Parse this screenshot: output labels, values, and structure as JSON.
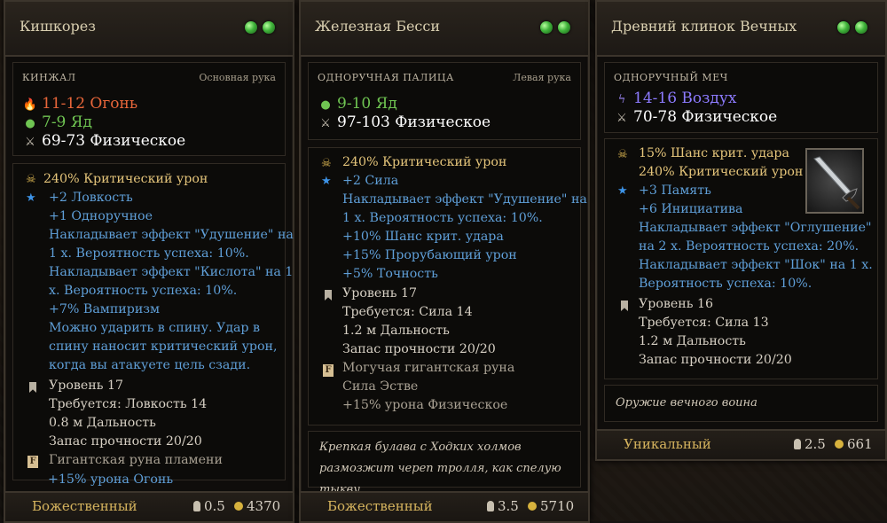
{
  "cards": [
    {
      "title": "Кишкорез",
      "base_type": "КИНЖАЛ",
      "slot": "Основная рука",
      "damage": [
        {
          "icon": "fire-icon",
          "text": "11-12 Огонь",
          "color": "#e8663a"
        },
        {
          "icon": "poison-icon",
          "text": "7-9 Яд",
          "color": "#6fc452"
        },
        {
          "icon": "swords-icon",
          "text": "69-73 Физическое",
          "color": "#ffffff"
        }
      ],
      "stats": [
        {
          "icon": "skull-icon",
          "text": "240% Критический урон",
          "cls": "gold"
        },
        {
          "icon": "star-icon",
          "text": "+2 Ловкость",
          "cls": "blue"
        },
        {
          "icon": "",
          "text": "+1 Одноручное",
          "cls": "blue"
        },
        {
          "icon": "",
          "text": "Накладывает эффект \"Удушение\" на",
          "cls": "blue"
        },
        {
          "icon": "",
          "text": "1 х. Вероятность успеха: 10%.",
          "cls": "blue"
        },
        {
          "icon": "",
          "text": "Накладывает эффект \"Кислота\" на 1",
          "cls": "blue"
        },
        {
          "icon": "",
          "text": "х. Вероятность успеха: 10%.",
          "cls": "blue"
        },
        {
          "icon": "",
          "text": "+7% Вампиризм",
          "cls": "blue"
        },
        {
          "icon": "",
          "text": "Можно ударить в спину. Удар в",
          "cls": "blue"
        },
        {
          "icon": "",
          "text": "спину наносит критический урон,",
          "cls": "blue"
        },
        {
          "icon": "",
          "text": "когда вы атакуете цель сзади.",
          "cls": "blue"
        },
        {
          "icon": "bookmark-icon",
          "text": "Уровень 17",
          "cls": "white"
        },
        {
          "icon": "",
          "text": "Требуется: Ловкость 14",
          "cls": "white"
        },
        {
          "icon": "",
          "text": "0.8 м Дальность",
          "cls": "white"
        },
        {
          "icon": "",
          "text": "Запас прочности 20/20",
          "cls": "white"
        },
        {
          "icon": "rune-icon",
          "text": "Гигантская руна пламени",
          "cls": "grey"
        },
        {
          "icon": "",
          "text": "+15% урона Огонь",
          "cls": "blue"
        }
      ],
      "description": "",
      "rarity": "Божественный",
      "weight": "0.5",
      "value": "4370"
    },
    {
      "title": "Железная Бесси",
      "base_type": "ОДНОРУЧНАЯ ПАЛИЦА",
      "slot": "Левая рука",
      "damage": [
        {
          "icon": "poison-icon",
          "text": "9-10 Яд",
          "color": "#6fc452"
        },
        {
          "icon": "swords-icon",
          "text": "97-103 Физическое",
          "color": "#ffffff"
        }
      ],
      "stats": [
        {
          "icon": "skull-icon",
          "text": "240% Критический урон",
          "cls": "gold"
        },
        {
          "icon": "star-icon",
          "text": "+2 Сила",
          "cls": "blue"
        },
        {
          "icon": "",
          "text": "Накладывает эффект \"Удушение\" на",
          "cls": "blue"
        },
        {
          "icon": "",
          "text": "1 х. Вероятность успеха: 10%.",
          "cls": "blue"
        },
        {
          "icon": "",
          "text": "+10% Шанс крит. удара",
          "cls": "blue"
        },
        {
          "icon": "",
          "text": "+15% Прорубающий урон",
          "cls": "blue"
        },
        {
          "icon": "",
          "text": "+5% Точность",
          "cls": "blue"
        },
        {
          "icon": "bookmark-icon",
          "text": "Уровень 17",
          "cls": "white"
        },
        {
          "icon": "",
          "text": "Требуется: Сила 14",
          "cls": "white"
        },
        {
          "icon": "",
          "text": "1.2 м Дальность",
          "cls": "white"
        },
        {
          "icon": "",
          "text": "Запас прочности 20/20",
          "cls": "white"
        },
        {
          "icon": "rune-icon",
          "text": "Могучая гигантская руна",
          "cls": "grey"
        },
        {
          "icon": "",
          "text": "Сила Эстве",
          "cls": "grey"
        },
        {
          "icon": "",
          "text": "+15% урона Физическое",
          "cls": "grey"
        }
      ],
      "description": "Крепкая булава с Ходких холмов размозжит череп тролля, как спелую тыкву.",
      "rarity": "Божественный",
      "weight": "3.5",
      "value": "5710"
    },
    {
      "title": "Древний клинок Вечных",
      "base_type": "ОДНОРУЧНЫЙ МЕЧ",
      "slot": "",
      "damage": [
        {
          "icon": "lightning-icon",
          "text": "14-16 Воздух",
          "color": "#8d7bff"
        },
        {
          "icon": "swords-icon",
          "text": "70-78 Физическое",
          "color": "#ffffff"
        }
      ],
      "stats": [
        {
          "icon": "skull-icon",
          "text": "15% Шанс крит. удара",
          "cls": "gold"
        },
        {
          "icon": "",
          "text": "240% Критический урон",
          "cls": "gold"
        },
        {
          "icon": "star-icon",
          "text": "+3 Память",
          "cls": "blue"
        },
        {
          "icon": "",
          "text": "+6 Инициатива",
          "cls": "blue"
        },
        {
          "icon": "",
          "text": "Накладывает эффект \"Оглушение\"",
          "cls": "blue"
        },
        {
          "icon": "",
          "text": "на 2 х. Вероятность успеха: 20%.",
          "cls": "blue"
        },
        {
          "icon": "",
          "text": "Накладывает эффект \"Шок\" на 1 х.",
          "cls": "blue"
        },
        {
          "icon": "",
          "text": "Вероятность успеха: 10%.",
          "cls": "blue"
        },
        {
          "icon": "bookmark-icon",
          "text": "Уровень 16",
          "cls": "white"
        },
        {
          "icon": "",
          "text": "Требуется: Сила 13",
          "cls": "white"
        },
        {
          "icon": "",
          "text": "1.2 м Дальность",
          "cls": "white"
        },
        {
          "icon": "",
          "text": "Запас прочности 20/20",
          "cls": "white"
        }
      ],
      "description": "Оружие вечного воина",
      "rarity": "Уникальный",
      "weight": "2.5",
      "value": "661"
    }
  ]
}
